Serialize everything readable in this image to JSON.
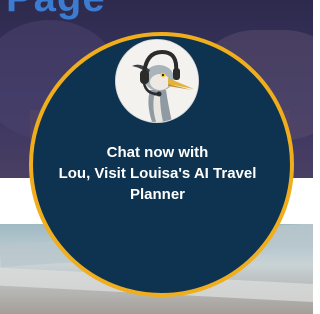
{
  "page": {
    "heading_fragment": "Page"
  },
  "chat_widget": {
    "line1": "Chat now with",
    "line2": "Lou, Visit Louisa's AI Travel",
    "line3": "Planner",
    "avatar_icon": "heron-with-headset-icon",
    "colors": {
      "circle": "#0e3350",
      "ring": "#f0ad1c",
      "text": "#ffffff"
    }
  }
}
